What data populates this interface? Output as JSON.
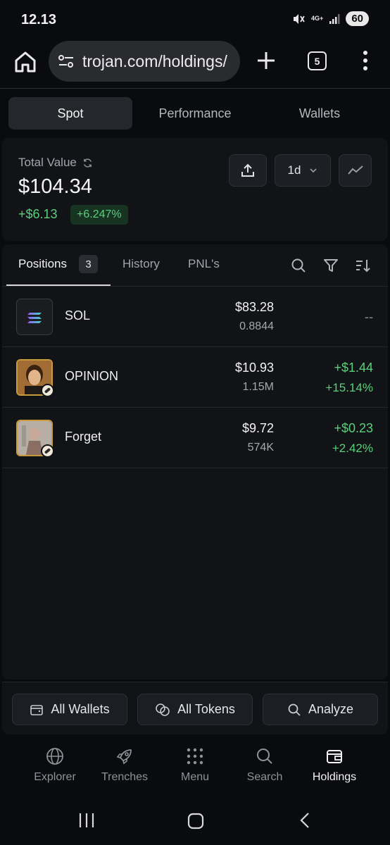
{
  "status": {
    "time": "12.13",
    "network": "4G+",
    "battery": "60"
  },
  "browser": {
    "url": "trojan.com/holdings/",
    "tab_count": "5"
  },
  "top_tabs": [
    {
      "label": "Spot",
      "active": true
    },
    {
      "label": "Performance",
      "active": false
    },
    {
      "label": "Wallets",
      "active": false
    }
  ],
  "summary": {
    "label": "Total Value",
    "amount": "$104.34",
    "change": "+$6.13",
    "change_pct": "+6.247%",
    "period": "1d"
  },
  "positions_tabs": {
    "positions": "Positions",
    "count": "3",
    "history": "History",
    "pnl": "PNL's"
  },
  "positions": [
    {
      "name": "SOL",
      "value": "$83.28",
      "amount": "0.8844",
      "pnl": "--",
      "pnl_pct": "",
      "icon": "solana-icon"
    },
    {
      "name": "OPINION",
      "value": "$10.93",
      "amount": "1.15M",
      "pnl": "+$1.44",
      "pnl_pct": "+15.14%",
      "icon": "opinion-token-icon"
    },
    {
      "name": "Forget",
      "value": "$9.72",
      "amount": "574K",
      "pnl": "+$0.23",
      "pnl_pct": "+2.42%",
      "icon": "forget-token-icon"
    }
  ],
  "actions": {
    "all_wallets": "All Wallets",
    "all_tokens": "All Tokens",
    "analyze": "Analyze"
  },
  "nav": [
    {
      "label": "Explorer",
      "icon": "globe-icon",
      "active": false
    },
    {
      "label": "Trenches",
      "icon": "rocket-icon",
      "active": false
    },
    {
      "label": "Menu",
      "icon": "grid-dots-icon",
      "active": false
    },
    {
      "label": "Search",
      "icon": "search-icon",
      "active": false
    },
    {
      "label": "Holdings",
      "icon": "wallet-icon",
      "active": true
    }
  ],
  "colors": {
    "positive": "#5bd07c",
    "background": "#0a0b0e",
    "card": "#111317"
  }
}
